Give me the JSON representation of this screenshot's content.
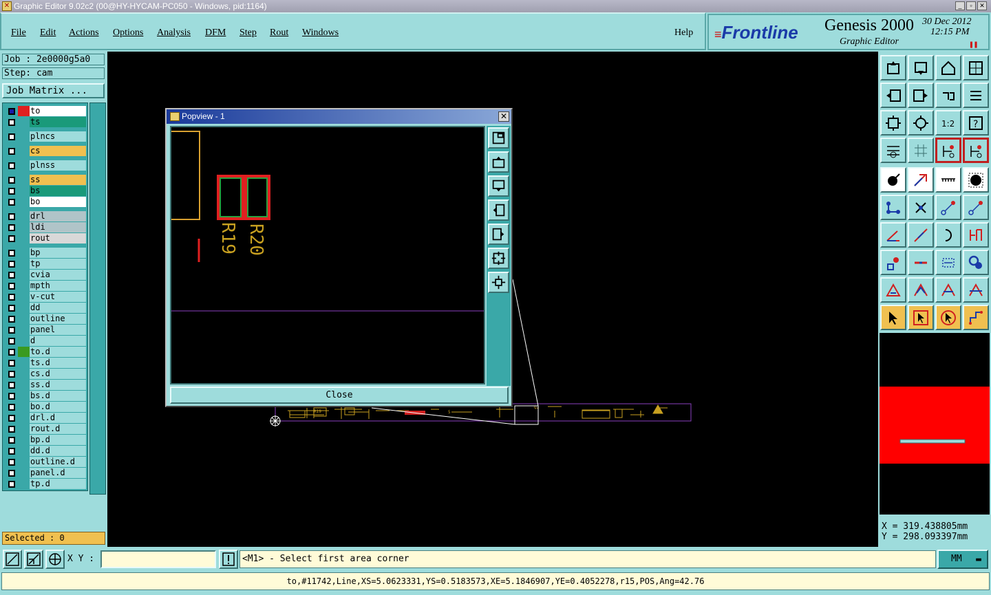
{
  "window": {
    "title": "Graphic Editor 9.02c2 (00@HY-HYCAM-PC050 - Windows, pid:1164)"
  },
  "menu": {
    "items": [
      "File",
      "Edit",
      "Actions",
      "Options",
      "Analysis",
      "DFM",
      "Step",
      "Rout",
      "Windows"
    ],
    "help": "Help"
  },
  "brand": {
    "logo": "Frontline",
    "product": "Genesis 2000",
    "subtitle": "Graphic Editor",
    "date": "30 Dec 2012",
    "time": "12:15 PM"
  },
  "job": {
    "job_label": "Job : 2e0000g5a0",
    "step_label": "Step: cam",
    "matrix_button": "Job Matrix ..."
  },
  "layers": [
    {
      "name": "to",
      "color": "#ffffff",
      "swatch": "#e02020",
      "active": true
    },
    {
      "name": "ts",
      "color": "#1a9a7a"
    },
    {
      "name": "plncs",
      "color": "#9edcdc"
    },
    {
      "name": "cs",
      "color": "#f0c050"
    },
    {
      "name": "plnss",
      "color": "#9edcdc"
    },
    {
      "name": "ss",
      "color": "#f0c050"
    },
    {
      "name": "bs",
      "color": "#1a9a7a"
    },
    {
      "name": "bo",
      "color": "#ffffff"
    },
    {
      "name": "drl",
      "color": "#b0c4c8"
    },
    {
      "name": "ldi",
      "color": "#b0c4c8"
    },
    {
      "name": "rout",
      "color": "#d8d8d8"
    },
    {
      "name": "bp",
      "color": "#9edcdc"
    },
    {
      "name": "tp",
      "color": "#9edcdc"
    },
    {
      "name": "cvia",
      "color": "#9edcdc"
    },
    {
      "name": "mpth",
      "color": "#9edcdc"
    },
    {
      "name": "v-cut",
      "color": "#9edcdc"
    },
    {
      "name": "dd",
      "color": "#9edcdc"
    },
    {
      "name": "outline",
      "color": "#9edcdc"
    },
    {
      "name": "panel",
      "color": "#9edcdc"
    },
    {
      "name": "d",
      "color": "#9edcdc"
    },
    {
      "name": "to.d",
      "color": "#9edcdc",
      "swatch": "#3a9a20"
    },
    {
      "name": "ts.d",
      "color": "#9edcdc"
    },
    {
      "name": "cs.d",
      "color": "#9edcdc"
    },
    {
      "name": "ss.d",
      "color": "#9edcdc"
    },
    {
      "name": "bs.d",
      "color": "#9edcdc"
    },
    {
      "name": "bo.d",
      "color": "#9edcdc"
    },
    {
      "name": "drl.d",
      "color": "#9edcdc"
    },
    {
      "name": "rout.d",
      "color": "#9edcdc"
    },
    {
      "name": "bp.d",
      "color": "#9edcdc"
    },
    {
      "name": "dd.d",
      "color": "#9edcdc"
    },
    {
      "name": "outline.d",
      "color": "#9edcdc"
    },
    {
      "name": "panel.d",
      "color": "#9edcdc"
    },
    {
      "name": "tp.d",
      "color": "#9edcdc"
    }
  ],
  "selected": "Selected : 0",
  "popview": {
    "title": "Popview - 1",
    "close_label": "Close",
    "texts": [
      "R19",
      "R20"
    ]
  },
  "coords": {
    "x": "X = 319.438805mm",
    "y": "Y = 298.093397mm"
  },
  "bottom": {
    "xy_label": "X Y :",
    "xy_value": "",
    "prompt": "<M1> - Select first area corner",
    "units": "MM"
  },
  "status": "to,#11742,Line,XS=5.0623331,YS=0.5183573,XE=5.1846907,YE=0.4052278,r15,POS,Ang=42.76",
  "colors": {
    "panel": "#9edcdc",
    "teal": "#3aa8a8",
    "canvas": "#000000",
    "selected": "#f0c050",
    "input": "#fffbd8"
  }
}
